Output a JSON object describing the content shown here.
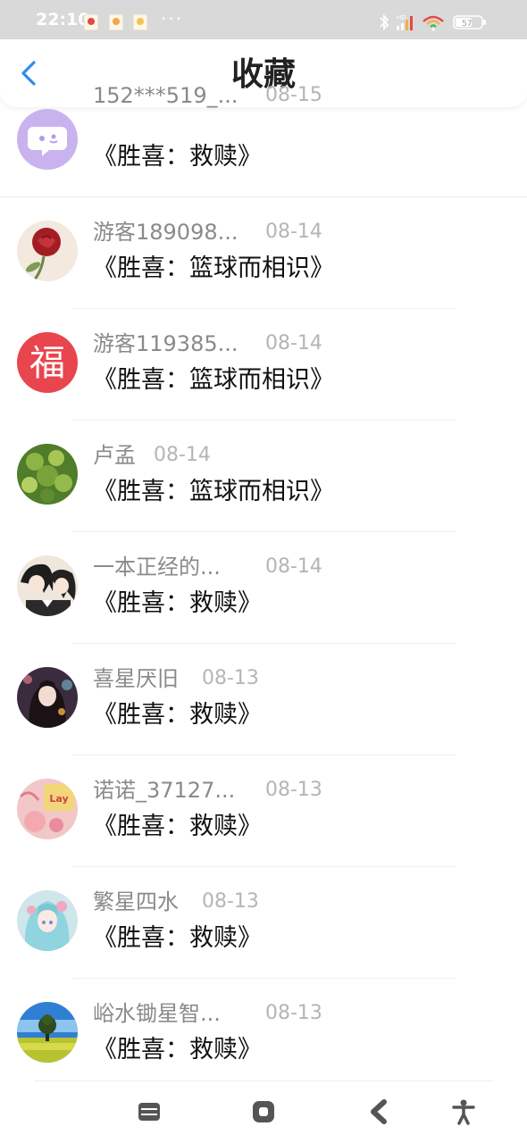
{
  "status_bar": {
    "time": "22:10",
    "more": "···",
    "battery": "57",
    "network_label": "HD"
  },
  "header": {
    "title": "收藏"
  },
  "items": [
    {
      "name": "152***519_...",
      "date": "08-15",
      "title": "《胜喜：救赎》",
      "avatar": "chat-bubble-avatar"
    },
    {
      "name": "游客189098...",
      "date": "08-14",
      "title": "《胜喜：篮球而相识》",
      "avatar": "rose-avatar"
    },
    {
      "name": "游客119385...",
      "date": "08-14",
      "title": "《胜喜：篮球而相识》",
      "avatar": "fu-character-avatar"
    },
    {
      "name": "卢孟",
      "date": "08-14",
      "title": "《胜喜：篮球而相识》",
      "avatar": "green-leaves-avatar"
    },
    {
      "name": "一本正经的...",
      "date": "08-14",
      "title": "《胜喜：救赎》",
      "avatar": "anime-girls-avatar"
    },
    {
      "name": "喜星厌旧",
      "date": "08-13",
      "title": "《胜喜：救赎》",
      "avatar": "anime-girl-dark-avatar"
    },
    {
      "name": "诺诺_37127...",
      "date": "08-13",
      "title": "《胜喜：救赎》",
      "avatar": "pink-sakura-avatar"
    },
    {
      "name": "繁星四水",
      "date": "08-13",
      "title": "《胜喜：救赎》",
      "avatar": "anime-girl-blue-avatar"
    },
    {
      "name": "峪水锄星智...",
      "date": "08-13",
      "title": "《胜喜：救赎》",
      "avatar": "landscape-tree-avatar"
    }
  ],
  "colors": {
    "accent": "#2d8cf0",
    "name_text": "#8a8a8a",
    "date_text": "#b5b5b5",
    "title_text": "#111111"
  }
}
